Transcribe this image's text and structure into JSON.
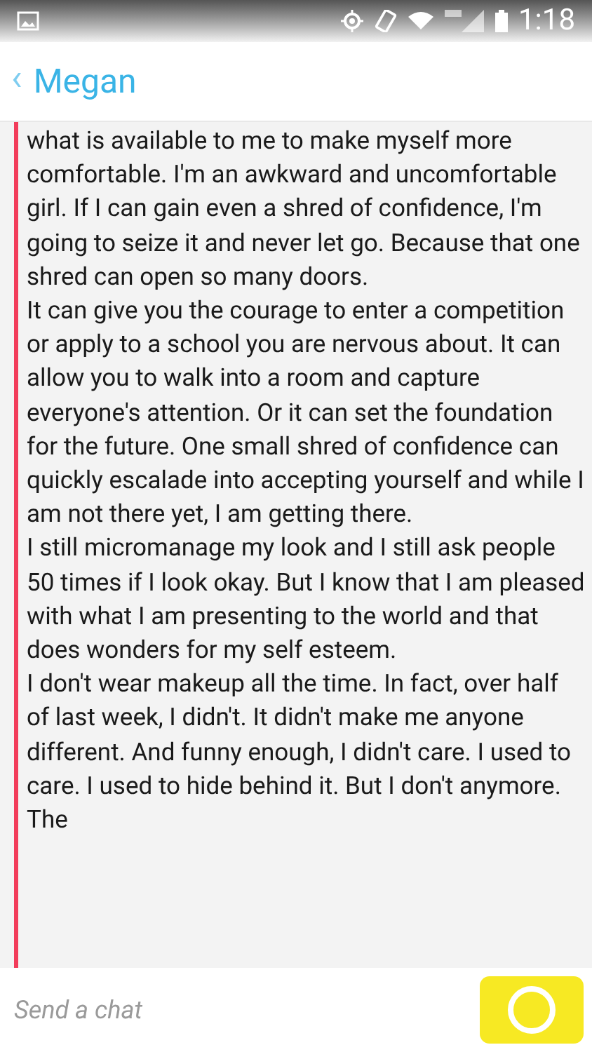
{
  "status_bar": {
    "time": "1:18"
  },
  "header": {
    "back": "‹",
    "title": "Megan"
  },
  "message": {
    "paragraphs": [
      "what is available to me to make myself more comfortable. I'm an awkward and uncomfortable girl. If I can gain even a shred of confidence, I'm going to seize it and never let go. Because that one shred can open so many doors.",
      "It can give you the courage to enter a competition or apply to a school you are nervous about. It can allow you to walk into a room and capture everyone's attention. Or it can set the foundation for the future. One small shred of confidence can quickly escalade into accepting yourself and while I am not there yet, I am getting there.",
      "I still micromanage my look and I still ask people 50 times if I look okay. But I know that I am pleased with what I am presenting to the world and that does wonders for my self esteem.",
      "I don't wear makeup all the time. In fact, over half of last week, I didn't. It didn't make me anyone different. And funny enough, I didn't care. I used to care. I used to hide behind it. But I don't anymore. The"
    ]
  },
  "composer": {
    "placeholder": "Send a chat"
  }
}
